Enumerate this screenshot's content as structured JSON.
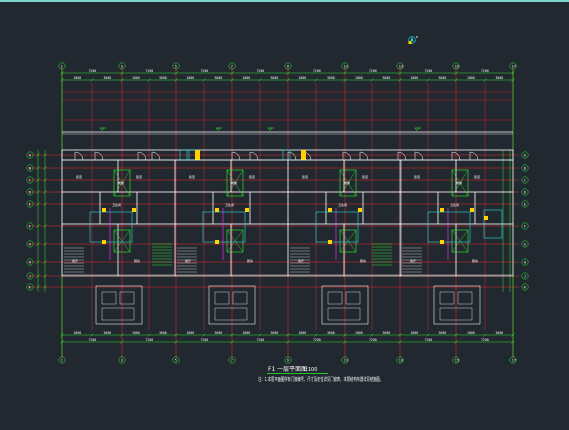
{
  "drawing": {
    "title": "F1 一层平面图",
    "scale": "1:100",
    "note": "注：1.本层平面图所有门窗编号、尺寸及定位详见门窗表，本层结构布置详见结施图。"
  },
  "north_arrow": {
    "label": "N"
  },
  "axes": {
    "columns": [
      "1",
      "2",
      "3",
      "4",
      "5",
      "6",
      "7",
      "8",
      "9",
      "10",
      "11",
      "12",
      "13",
      "14",
      "15",
      "16",
      "17",
      "18"
    ],
    "rows": [
      "A",
      "B",
      "C",
      "D",
      "E",
      "F",
      "G",
      "H",
      "J",
      "K"
    ]
  },
  "dimensions": {
    "top_outer": [
      "7200",
      "7200",
      "7200",
      "7200",
      "7200",
      "7200",
      "7200"
    ],
    "top_inner": [
      "1800",
      "3600",
      "1800",
      "3600",
      "1800",
      "3600",
      "1800",
      "3600",
      "1800",
      "3600",
      "1800",
      "3600",
      "1800",
      "3600"
    ],
    "bottom_outer": [
      "7200",
      "7200",
      "7200",
      "7200",
      "7200",
      "7200",
      "7200"
    ],
    "bottom_inner": [
      "1800",
      "3600",
      "1800",
      "3600",
      "1800",
      "3600",
      "1800",
      "3600",
      "1800",
      "3600",
      "1800",
      "3600",
      "1800",
      "3600"
    ]
  },
  "units": [
    {
      "rooms": [
        "卧室",
        "卧室",
        "客厅",
        "厨房",
        "卫生间",
        "电梯"
      ]
    },
    {
      "rooms": [
        "卧室",
        "卧室",
        "客厅",
        "厨房",
        "卫生间",
        "电梯"
      ]
    },
    {
      "rooms": [
        "卧室",
        "卧室",
        "客厅",
        "厨房",
        "卫生间",
        "电梯"
      ]
    },
    {
      "rooms": [
        "卧室",
        "卧室",
        "客厅",
        "厨房",
        "卫生间",
        "电梯"
      ]
    }
  ],
  "colors": {
    "background": "#212830",
    "grid_axis": "#ff2a2a",
    "wall": "#ffffff",
    "dimension": "#2cf52c",
    "elevator": "#2cf52c",
    "core": "#22e0e0",
    "accent": "#ffd400",
    "rail": "#ff33ff"
  }
}
